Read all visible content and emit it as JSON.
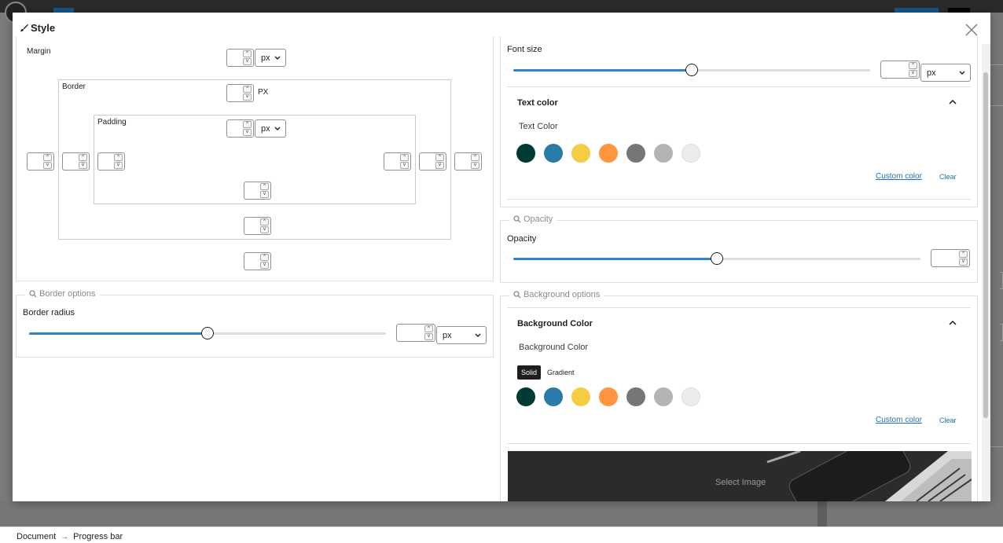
{
  "background": {
    "breadcrumb": {
      "items": [
        "Document",
        "Progress bar"
      ],
      "separator": "→"
    }
  },
  "modal": {
    "title": "Style",
    "title_icon": "brush-icon",
    "close_icon": "close-icon"
  },
  "spacing": {
    "margin_label": "Margin",
    "border_label": "Border",
    "padding_label": "Padding",
    "margin_unit": "px",
    "border_unit": "PX",
    "padding_unit": "px",
    "values": {
      "margin": "",
      "border": "",
      "padding": ""
    }
  },
  "border_options": {
    "legend": "Border options",
    "radius_label": "Border radius",
    "radius_value": "",
    "radius_unit": "px",
    "slider_level": 0.5
  },
  "typography": {
    "font_size_label": "Font size",
    "font_size_value": "",
    "font_size_unit": "px",
    "slider_level": 0.5,
    "text_color_header": "Text color",
    "text_color_label": "Text Color",
    "custom_color": "Custom color",
    "clear": "Clear",
    "swatches": [
      "#003a34",
      "#2a7ba8",
      "#f7cc45",
      "#ff953f",
      "#767676",
      "#b4b4b4",
      "#ececec"
    ]
  },
  "opacity": {
    "legend": "Opacity",
    "label": "Opacity",
    "value": "",
    "slider_level": 0.5
  },
  "background_options": {
    "legend": "Background options",
    "header": "Background Color",
    "label": "Background Color",
    "tabs": [
      "Solid",
      "Gradient"
    ],
    "active_tab": "Solid",
    "custom_color": "Custom color",
    "clear": "Clear",
    "swatches": [
      "#003a34",
      "#2a7ba8",
      "#f7cc45",
      "#ff953f",
      "#767676",
      "#b4b4b4",
      "#ececec"
    ],
    "select_image": "Select Image"
  },
  "colors": {
    "accent": "#2271b1",
    "slider": "#3582c4"
  }
}
